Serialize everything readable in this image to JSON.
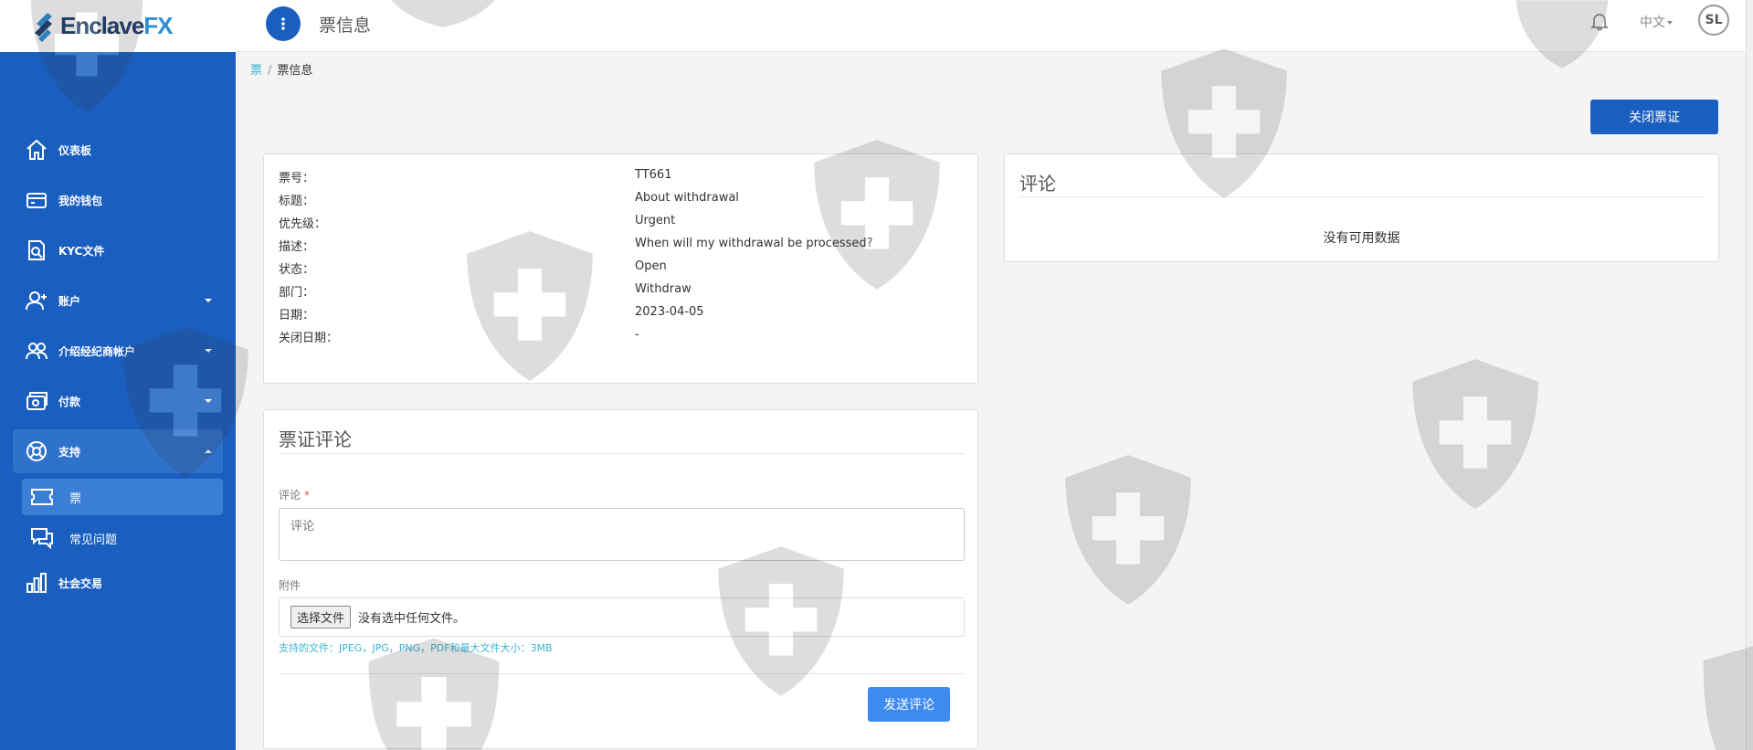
{
  "brand": {
    "name_main": "Enclave",
    "name_accent": "FX"
  },
  "header": {
    "title": "票信息",
    "language": "中文",
    "avatar_initials": "SL"
  },
  "sidebar": {
    "items": [
      {
        "label": "仪表板",
        "icon": "home-icon"
      },
      {
        "label": "我的钱包",
        "icon": "wallet-icon"
      },
      {
        "label": "KYC文件",
        "icon": "document-search-icon"
      },
      {
        "label": "账户",
        "icon": "add-user-icon"
      },
      {
        "label": "介绍经纪商帐户",
        "icon": "users-icon"
      },
      {
        "label": "付款",
        "icon": "payment-icon"
      },
      {
        "label": "支持",
        "icon": "lifebuoy-icon"
      },
      {
        "label": "社会交易",
        "icon": "bar-chart-icon"
      }
    ],
    "sub_items": [
      {
        "label": "票",
        "icon": "ticket-icon"
      },
      {
        "label": "常见问题",
        "icon": "chat-icon"
      }
    ]
  },
  "breadcrumb": {
    "link": "票",
    "current": "票信息"
  },
  "actions": {
    "close_ticket": "关闭票证"
  },
  "ticket": {
    "rows": [
      {
        "key": "票号：",
        "value": "TT661"
      },
      {
        "key": "标题：",
        "value": "About withdrawal"
      },
      {
        "key": "优先级：",
        "value": "Urgent"
      },
      {
        "key": "描述：",
        "value": "When will my withdrawal be processed?"
      },
      {
        "key": "状态：",
        "value": "Open"
      },
      {
        "key": "部门：",
        "value": "Withdraw"
      },
      {
        "key": "日期：",
        "value": "2023-04-05"
      },
      {
        "key": "关闭日期：",
        "value": "-"
      }
    ]
  },
  "comments": {
    "title": "评论",
    "empty": "没有可用数据"
  },
  "comment_form": {
    "title": "票证评论",
    "comment_label": "评论",
    "required_mark": "*",
    "comment_placeholder": "评论",
    "attachment_label": "附件",
    "choose_file": "选择文件",
    "no_file": "没有选中任何文件。",
    "hint": "支持的文件：JPEG，JPG，PNG，PDF和最大文件大小：3MB",
    "send": "发送评论"
  },
  "colors": {
    "primary": "#1a5fbf",
    "accent": "#3bb3d4",
    "send": "#3d8af0"
  }
}
